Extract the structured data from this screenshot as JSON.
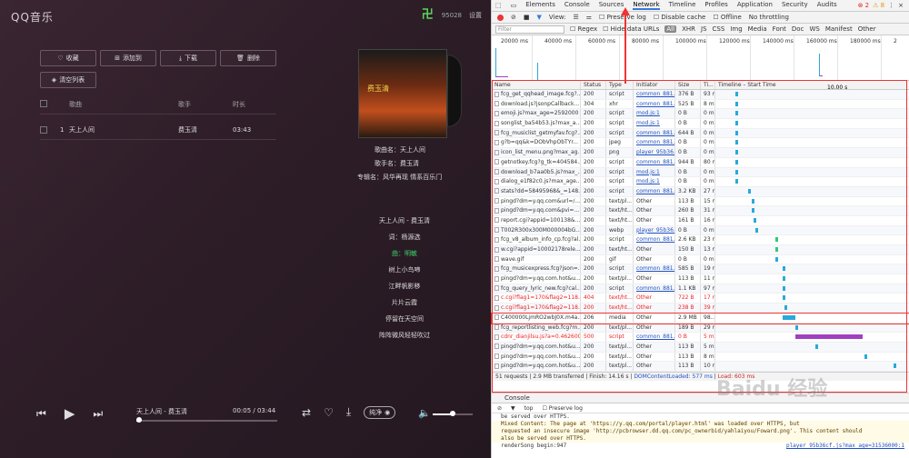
{
  "player": {
    "logo": "QQ音乐",
    "uid": "95028",
    "settings": "设置",
    "avatar": "卍",
    "toolbar": [
      "收藏",
      "添加到",
      "下载",
      "删除",
      "清空列表"
    ],
    "cols": {
      "song": "歌曲",
      "singer": "歌手",
      "duration": "时长"
    },
    "row": {
      "index": "1",
      "song": "天上人间",
      "singer": "费玉清",
      "duration": "03:43"
    },
    "cover_label": "费玉清",
    "meta": {
      "song": "歌曲名：天上人间",
      "singer": "歌手名：费玉清",
      "album": "专辑名：风华再现 情系百乐门"
    },
    "lyrics": [
      "天上人间 - 费玉清",
      "词：杨源选",
      "曲：明敏",
      "树上小鸟啼",
      "江畔帆影移",
      "片片云霞",
      "停留在天空间",
      "阵阵微风轻轻吹过"
    ],
    "active_lyric_index": 2,
    "now_playing": "天上人间 - 费玉清",
    "time": "00:05 / 03:44",
    "progress_fraction": 0.02,
    "quality": "纯净",
    "volume_fraction": 0.5
  },
  "devtools": {
    "tabs": [
      "Elements",
      "Console",
      "Sources",
      "Network",
      "Timeline",
      "Profiles",
      "Application",
      "Security",
      "Audits"
    ],
    "active_tab": "Network",
    "errors": "2",
    "warnings": "8",
    "tools": {
      "view": "View:",
      "preserve": "Preserve log",
      "disable_cache": "Disable cache",
      "offline": "Offline",
      "throttle": "No throttling"
    },
    "filter": {
      "placeholder": "Filter",
      "regex": "Regex",
      "hide": "Hide data URLs",
      "types": [
        "All",
        "XHR",
        "JS",
        "CSS",
        "Img",
        "Media",
        "Font",
        "Doc",
        "WS",
        "Manifest",
        "Other"
      ]
    },
    "overview_ticks": [
      "20000 ms",
      "40000 ms",
      "60000 ms",
      "80000 ms",
      "100000 ms",
      "120000 ms",
      "140000 ms",
      "160000 ms",
      "180000 ms",
      "2"
    ],
    "headers": [
      "Name",
      "Status",
      "Type",
      "Initiator",
      "Size",
      "Ti...",
      "Timeline – Start Time",
      "10.00 s"
    ],
    "rows": [
      [
        "fcg_get_qqhead_image.fcg?...",
        "200",
        "script",
        "common_881...",
        "376 B",
        "93 ms"
      ],
      [
        "download.js?jsonpCallback...",
        "304",
        "xhr",
        "common_881...",
        "525 B",
        "8 ms"
      ],
      [
        "emoji.js?max_age=2592000",
        "200",
        "script",
        "mod.js:1",
        "0 B",
        "0 ms"
      ],
      [
        "songlist_ba54b53.js?max_a...",
        "200",
        "script",
        "mod.js:1",
        "0 B",
        "0 ms"
      ],
      [
        "fcg_musiclist_getmyfav.fcg?...",
        "200",
        "script",
        "common_881...",
        "644 B",
        "0 ms"
      ],
      [
        "g?b=qq&k=DObVhpObTYr...",
        "200",
        "jpeg",
        "common_881...",
        "0 B",
        "0 ms"
      ],
      [
        "icon_list_menu.png?max_ag...",
        "200",
        "png",
        "player_95b36...",
        "0 B",
        "0 ms"
      ],
      [
        "getnotkey.fcg?g_tk=404584...",
        "200",
        "script",
        "common_881...",
        "944 B",
        "80 ms"
      ],
      [
        "download_b7aa0b5.js?max_...",
        "200",
        "script",
        "mod.js:1",
        "0 B",
        "0 ms"
      ],
      [
        "dialog_e1f82c0.js?max_age...",
        "200",
        "script",
        "mod.js:1",
        "0 B",
        "0 ms"
      ],
      [
        "stats?dd=58495968&_=148...",
        "200",
        "script",
        "common_881...",
        "3.2 KB",
        "27 ms"
      ],
      [
        "pingd?dm=y.qq.com&url=/...",
        "200",
        "text/pl...",
        "Other",
        "113 B",
        "15 ms"
      ],
      [
        "pingd?dm=y.qq.com&pvi=...",
        "200",
        "text/ht...",
        "Other",
        "260 B",
        "31 ms"
      ],
      [
        "report.cgi?appid=100138&...",
        "200",
        "text/ht...",
        "Other",
        "161 B",
        "16 ms"
      ],
      [
        "T002R300x300M000004bG...",
        "200",
        "webp",
        "player_95b36...",
        "0 B",
        "0 ms"
      ],
      [
        "fcg_v8_album_info_cp.fcg?al...",
        "200",
        "script",
        "common_881...",
        "2.6 KB",
        "23 ms"
      ],
      [
        "w.cgi?appid=10002178rele...",
        "200",
        "text/ht...",
        "Other",
        "150 B",
        "13 ms"
      ],
      [
        "wave.gif",
        "200",
        "gif",
        "Other",
        "0 B",
        "0 ms"
      ],
      [
        "fcg_musicexpress.fcg?json=...",
        "200",
        "script",
        "common_881...",
        "585 B",
        "19 ms"
      ],
      [
        "pingd?dm=y.qq.com.hot&u...",
        "200",
        "text/pl...",
        "Other",
        "113 B",
        "11 ms"
      ],
      [
        "fcg_query_lyric_new.fcg?cal...",
        "200",
        "script",
        "common_881...",
        "1.1 KB",
        "97 ms"
      ],
      [
        "c.cgi?flag1=170&flag2=118...",
        "404",
        "text/ht...",
        "Other",
        "722 B",
        "17 ms"
      ],
      [
        "c.cgi?flag1=170&flag2=118...",
        "200",
        "text/ht...",
        "Other",
        "238 B",
        "39 ms"
      ],
      [
        "C400000LjmRO2wbJ0X.m4a...",
        "206",
        "media",
        "Other",
        "2.9 MB",
        "98..."
      ],
      [
        "fcg_reportlisting_web.fcg?m...",
        "200",
        "text/pl...",
        "Other",
        "189 B",
        "29 ms"
      ],
      [
        "cdnr_dianjilsu.js?a=0.462600...",
        "500",
        "script",
        "common_881...",
        "0 B",
        "5 ms"
      ],
      [
        "pingd?dm=y.qq.com.hot&u...",
        "200",
        "text/pl...",
        "Other",
        "113 B",
        "5 ms"
      ],
      [
        "pingd?dm=y.qq.com.hot&u...",
        "200",
        "text/pl...",
        "Other",
        "113 B",
        "8 ms"
      ],
      [
        "pingd?dm=y.qq.com.hot&u...",
        "200",
        "text/pl...",
        "Other",
        "113 B",
        "10 ms"
      ]
    ],
    "error_rows": [
      21,
      22,
      25
    ],
    "selected_row": 23,
    "status": {
      "requests": "51 requests",
      "transferred": "2.9 MB transferred",
      "finish": "Finish: 14.16 s",
      "dcl": "DOMContentLoaded: 577 ms",
      "load": "Load: 603 ms"
    },
    "console": {
      "tab": "Console",
      "context": "top",
      "preserve": "Preserve log",
      "lines": [
        "be served over HTTPS.",
        "Mixed Content: The page at 'https://y.qq.com/portal/player.html' was loaded over HTTPS, but",
        "requested an insecure image 'http://pcbrowser.dd.qq.com/pc_ownerbid/yahlaiyou/Foward.png'. This content should",
        "also be served over HTTPS.",
        "renderSong begin:947"
      ],
      "source": "player_95b36cf.js?max_age=31536000:1"
    },
    "watermark": "Baidu 经验"
  }
}
